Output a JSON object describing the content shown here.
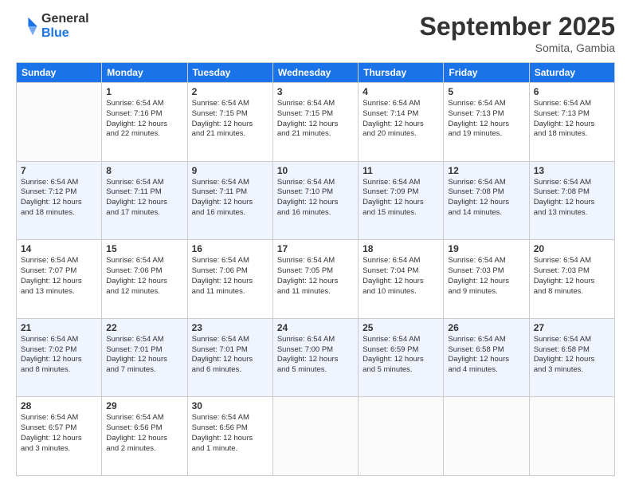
{
  "logo": {
    "line1": "General",
    "line2": "Blue"
  },
  "header": {
    "month": "September 2025",
    "location": "Somita, Gambia"
  },
  "weekdays": [
    "Sunday",
    "Monday",
    "Tuesday",
    "Wednesday",
    "Thursday",
    "Friday",
    "Saturday"
  ],
  "weeks": [
    [
      {
        "day": "",
        "info": ""
      },
      {
        "day": "1",
        "info": "Sunrise: 6:54 AM\nSunset: 7:16 PM\nDaylight: 12 hours\nand 22 minutes."
      },
      {
        "day": "2",
        "info": "Sunrise: 6:54 AM\nSunset: 7:15 PM\nDaylight: 12 hours\nand 21 minutes."
      },
      {
        "day": "3",
        "info": "Sunrise: 6:54 AM\nSunset: 7:15 PM\nDaylight: 12 hours\nand 21 minutes."
      },
      {
        "day": "4",
        "info": "Sunrise: 6:54 AM\nSunset: 7:14 PM\nDaylight: 12 hours\nand 20 minutes."
      },
      {
        "day": "5",
        "info": "Sunrise: 6:54 AM\nSunset: 7:13 PM\nDaylight: 12 hours\nand 19 minutes."
      },
      {
        "day": "6",
        "info": "Sunrise: 6:54 AM\nSunset: 7:13 PM\nDaylight: 12 hours\nand 18 minutes."
      }
    ],
    [
      {
        "day": "7",
        "info": "Sunrise: 6:54 AM\nSunset: 7:12 PM\nDaylight: 12 hours\nand 18 minutes."
      },
      {
        "day": "8",
        "info": "Sunrise: 6:54 AM\nSunset: 7:11 PM\nDaylight: 12 hours\nand 17 minutes."
      },
      {
        "day": "9",
        "info": "Sunrise: 6:54 AM\nSunset: 7:11 PM\nDaylight: 12 hours\nand 16 minutes."
      },
      {
        "day": "10",
        "info": "Sunrise: 6:54 AM\nSunset: 7:10 PM\nDaylight: 12 hours\nand 16 minutes."
      },
      {
        "day": "11",
        "info": "Sunrise: 6:54 AM\nSunset: 7:09 PM\nDaylight: 12 hours\nand 15 minutes."
      },
      {
        "day": "12",
        "info": "Sunrise: 6:54 AM\nSunset: 7:08 PM\nDaylight: 12 hours\nand 14 minutes."
      },
      {
        "day": "13",
        "info": "Sunrise: 6:54 AM\nSunset: 7:08 PM\nDaylight: 12 hours\nand 13 minutes."
      }
    ],
    [
      {
        "day": "14",
        "info": "Sunrise: 6:54 AM\nSunset: 7:07 PM\nDaylight: 12 hours\nand 13 minutes."
      },
      {
        "day": "15",
        "info": "Sunrise: 6:54 AM\nSunset: 7:06 PM\nDaylight: 12 hours\nand 12 minutes."
      },
      {
        "day": "16",
        "info": "Sunrise: 6:54 AM\nSunset: 7:06 PM\nDaylight: 12 hours\nand 11 minutes."
      },
      {
        "day": "17",
        "info": "Sunrise: 6:54 AM\nSunset: 7:05 PM\nDaylight: 12 hours\nand 11 minutes."
      },
      {
        "day": "18",
        "info": "Sunrise: 6:54 AM\nSunset: 7:04 PM\nDaylight: 12 hours\nand 10 minutes."
      },
      {
        "day": "19",
        "info": "Sunrise: 6:54 AM\nSunset: 7:03 PM\nDaylight: 12 hours\nand 9 minutes."
      },
      {
        "day": "20",
        "info": "Sunrise: 6:54 AM\nSunset: 7:03 PM\nDaylight: 12 hours\nand 8 minutes."
      }
    ],
    [
      {
        "day": "21",
        "info": "Sunrise: 6:54 AM\nSunset: 7:02 PM\nDaylight: 12 hours\nand 8 minutes."
      },
      {
        "day": "22",
        "info": "Sunrise: 6:54 AM\nSunset: 7:01 PM\nDaylight: 12 hours\nand 7 minutes."
      },
      {
        "day": "23",
        "info": "Sunrise: 6:54 AM\nSunset: 7:01 PM\nDaylight: 12 hours\nand 6 minutes."
      },
      {
        "day": "24",
        "info": "Sunrise: 6:54 AM\nSunset: 7:00 PM\nDaylight: 12 hours\nand 5 minutes."
      },
      {
        "day": "25",
        "info": "Sunrise: 6:54 AM\nSunset: 6:59 PM\nDaylight: 12 hours\nand 5 minutes."
      },
      {
        "day": "26",
        "info": "Sunrise: 6:54 AM\nSunset: 6:58 PM\nDaylight: 12 hours\nand 4 minutes."
      },
      {
        "day": "27",
        "info": "Sunrise: 6:54 AM\nSunset: 6:58 PM\nDaylight: 12 hours\nand 3 minutes."
      }
    ],
    [
      {
        "day": "28",
        "info": "Sunrise: 6:54 AM\nSunset: 6:57 PM\nDaylight: 12 hours\nand 3 minutes."
      },
      {
        "day": "29",
        "info": "Sunrise: 6:54 AM\nSunset: 6:56 PM\nDaylight: 12 hours\nand 2 minutes."
      },
      {
        "day": "30",
        "info": "Sunrise: 6:54 AM\nSunset: 6:56 PM\nDaylight: 12 hours\nand 1 minute."
      },
      {
        "day": "",
        "info": ""
      },
      {
        "day": "",
        "info": ""
      },
      {
        "day": "",
        "info": ""
      },
      {
        "day": "",
        "info": ""
      }
    ]
  ]
}
